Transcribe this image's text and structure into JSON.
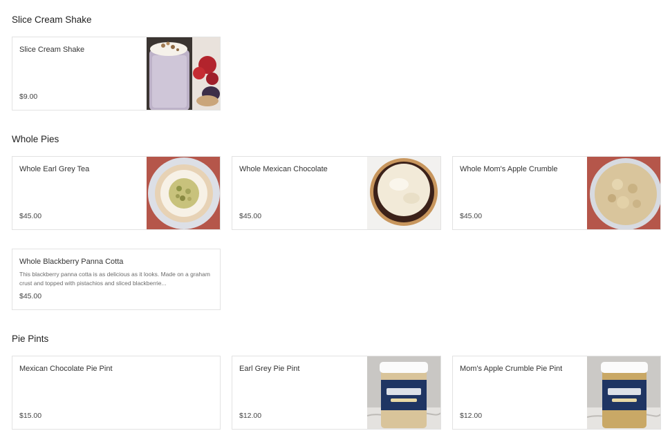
{
  "sections": [
    {
      "title": "Slice Cream Shake",
      "items": [
        {
          "name": "Slice Cream Shake",
          "price": "$9.00"
        }
      ]
    },
    {
      "title": "Whole Pies",
      "items": [
        {
          "name": "Whole Earl Grey Tea",
          "price": "$45.00"
        },
        {
          "name": "Whole Mexican Chocolate",
          "price": "$45.00"
        },
        {
          "name": "Whole Mom's Apple Crumble",
          "price": "$45.00"
        },
        {
          "name": "Whole Blackberry Panna Cotta",
          "description": "This blackberry panna cotta is as delicious as it looks. Made on a graham crust and topped with pistachios and sliced blackberrie...",
          "price": "$45.00"
        }
      ]
    },
    {
      "title": "Pie Pints",
      "items": [
        {
          "name": "Mexican Chocolate Pie Pint",
          "price": "$15.00"
        },
        {
          "name": "Earl Grey Pie Pint",
          "price": "$12.00"
        },
        {
          "name": "Mom's Apple Crumble Pie Pint",
          "price": "$12.00"
        }
      ]
    }
  ]
}
